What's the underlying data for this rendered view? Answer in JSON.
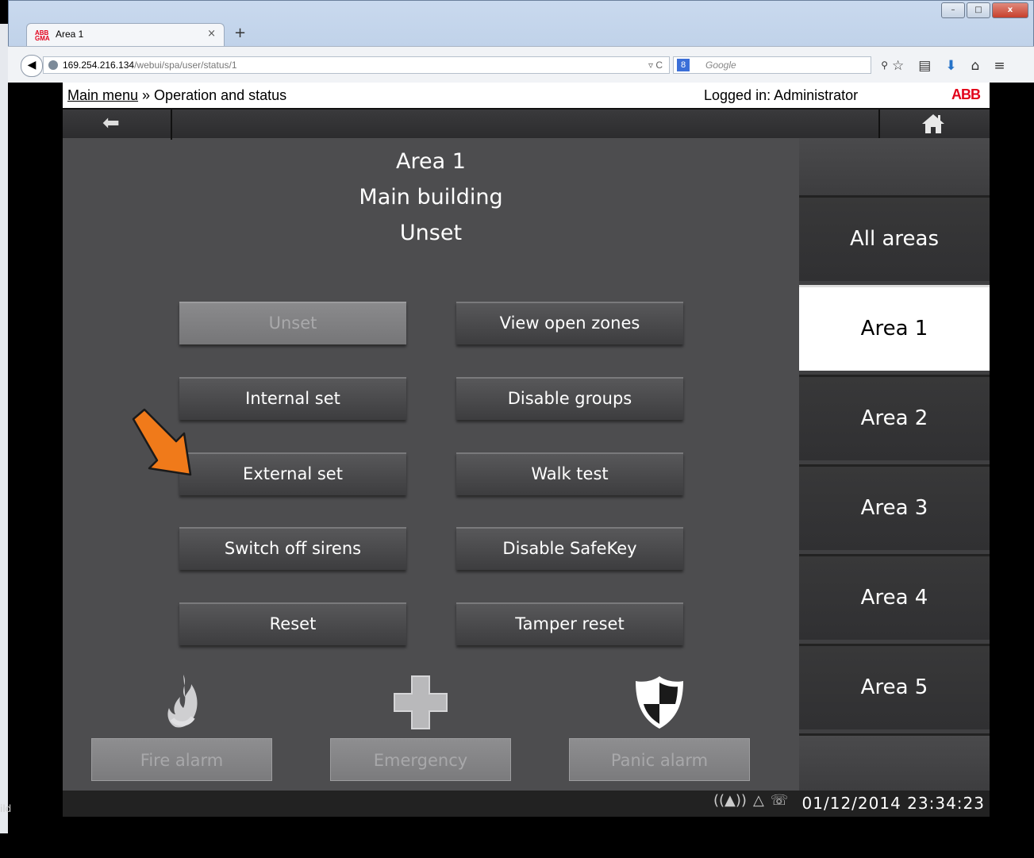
{
  "browser": {
    "tab_title": "Area 1",
    "url_host": "169.254.216.134",
    "url_path": "/webui/spa/user/status/1",
    "search_placeholder": "Google",
    "stray_text": "ild"
  },
  "header": {
    "main_menu_link": "Main menu",
    "breadcrumb_rest": " » Operation and status",
    "logged_in": "Logged in: Administrator",
    "logo": "ABB"
  },
  "area": {
    "name": "Area 1",
    "description": "Main building",
    "state": "Unset"
  },
  "buttons_left": [
    "Unset",
    "Internal set",
    "External set",
    "Switch off sirens",
    "Reset"
  ],
  "buttons_right": [
    "View open zones",
    "Disable groups",
    "Walk test",
    "Disable SafeKey",
    "Tamper reset"
  ],
  "alarms": [
    "Fire alarm",
    "Emergency",
    "Panic alarm"
  ],
  "sidebar": [
    "All areas",
    "Area 1",
    "Area 2",
    "Area 3",
    "Area 4",
    "Area 5"
  ],
  "status_bar": {
    "datetime": "01/12/2014 23:34:23"
  },
  "colors": {
    "accent_arrow": "#f07a1a",
    "brand_red": "#e2001a"
  }
}
